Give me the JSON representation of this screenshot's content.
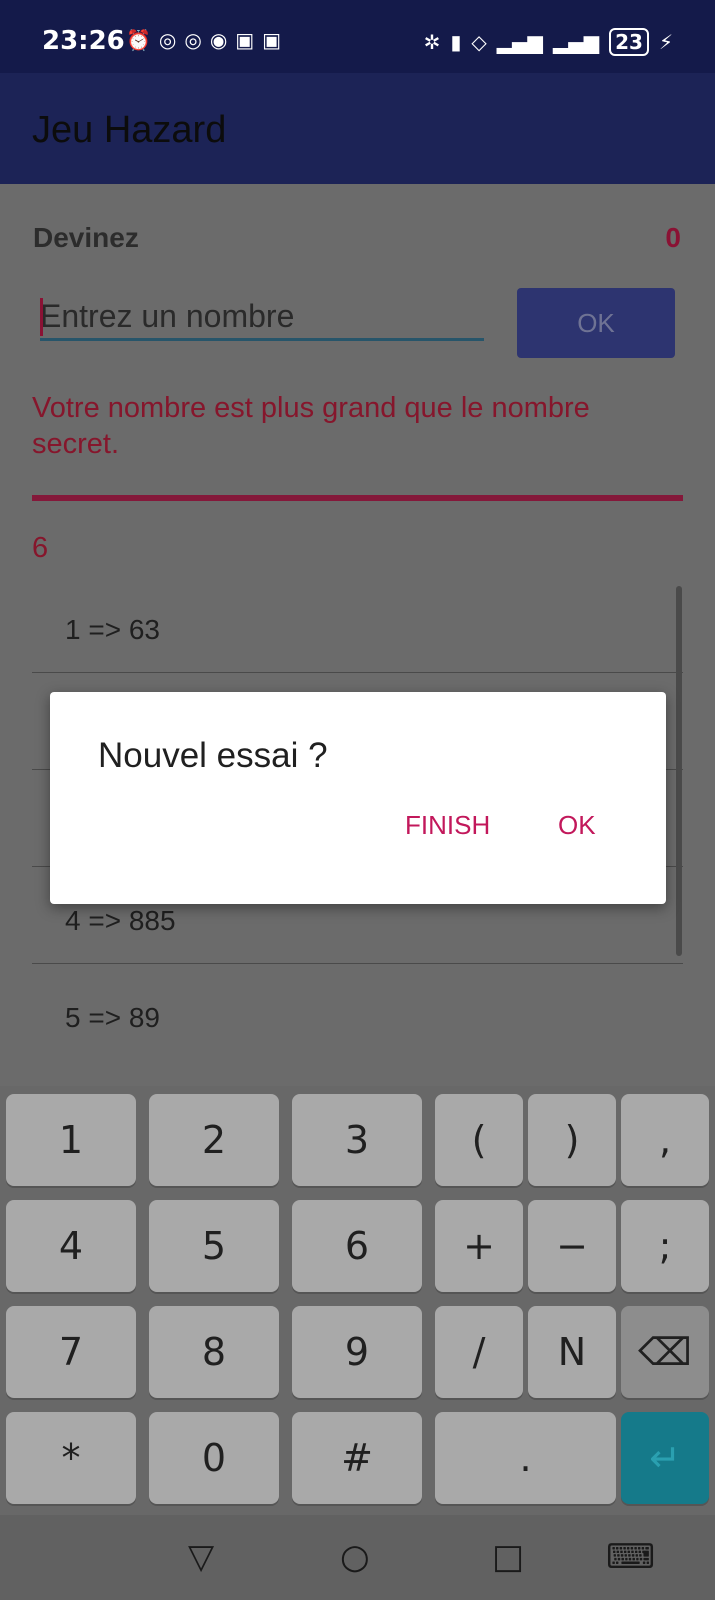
{
  "status_bar": {
    "time": "23:26",
    "battery": "23",
    "left_icons": [
      "⏰",
      "◎",
      "◎",
      "◉",
      "▣",
      "▣"
    ],
    "right_icons": [
      "✲",
      "▮",
      "◇",
      "▂▄▆",
      "▂▄▆",
      "⚡"
    ]
  },
  "app_bar": {
    "title": "Jeu Hazard"
  },
  "game": {
    "label": "Devinez",
    "score": "0",
    "input_placeholder": "Entrez un nombre",
    "input_value": "",
    "ok_button": "OK",
    "message": "Votre nombre est plus grand que le nombre secret.",
    "attempt_count": "6"
  },
  "attempts": [
    {
      "text": "1 => 63"
    },
    {
      "text": ""
    },
    {
      "text": ""
    },
    {
      "text": "4 => 885"
    },
    {
      "text": "5 => 89"
    }
  ],
  "dialog": {
    "title": "Nouvel essai ?",
    "finish_button": "FINISH",
    "ok_button": "OK"
  },
  "keyboard": {
    "row1": [
      "1",
      "2",
      "3",
      "(",
      ")",
      ","
    ],
    "row2": [
      "4",
      "5",
      "6",
      "+",
      "−",
      ";"
    ],
    "row3": [
      "7",
      "8",
      "9",
      "/",
      "N",
      "⌫"
    ],
    "row4": [
      "*",
      "0",
      "#",
      ".",
      "↵"
    ]
  },
  "nav_bar": {
    "back": "▽",
    "home": "○",
    "recents": "□",
    "keyboard": "⌨"
  }
}
